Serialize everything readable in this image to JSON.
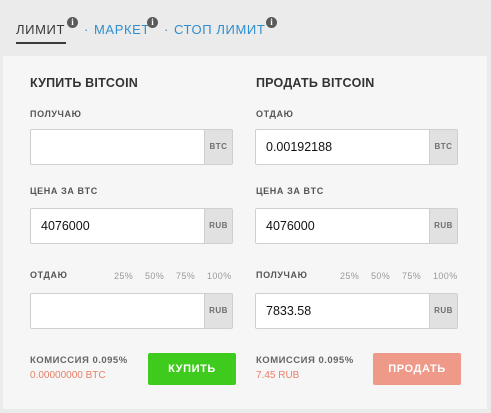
{
  "tabs": [
    {
      "label": "ЛИМИТ",
      "info": "i"
    },
    {
      "label": "МАРКЕТ",
      "info": "i"
    },
    {
      "label": "СТОП ЛИМИТ",
      "info": "i"
    }
  ],
  "separator": "·",
  "buy": {
    "title": "КУПИТЬ BITCOIN",
    "receive_label": "ПОЛУЧАЮ",
    "receive_value": "",
    "receive_currency": "BTC",
    "price_label": "ЦЕНА ЗА BTC",
    "price_value": "4076000",
    "price_currency": "RUB",
    "give_label": "ОТДАЮ",
    "give_value": "",
    "give_currency": "RUB",
    "percents": [
      "25%",
      "50%",
      "75%",
      "100%"
    ],
    "fee_label": "КОМИССИЯ 0.095%",
    "fee_value": "0.00000000",
    "fee_currency": "BTC",
    "button": "КУПИТЬ"
  },
  "sell": {
    "title": "ПРОДАТЬ BITCOIN",
    "give_label": "ОТДАЮ",
    "give_value": "0.00192188",
    "give_currency": "BTC",
    "price_label": "ЦЕНА ЗА BTC",
    "price_value": "4076000",
    "price_currency": "RUB",
    "receive_label": "ПОЛУЧАЮ",
    "receive_value": "7833.58",
    "receive_currency": "RUB",
    "percents": [
      "25%",
      "50%",
      "75%",
      "100%"
    ],
    "fee_label": "КОМИССИЯ 0.095%",
    "fee_value": "7.45 RUB",
    "button": "ПРОДАТЬ"
  },
  "colors": {
    "buy_button": "#3fcb1e",
    "sell_button": "#ef9a88",
    "tab_link": "#2f8ecf",
    "fee_value": "#e8806a"
  }
}
